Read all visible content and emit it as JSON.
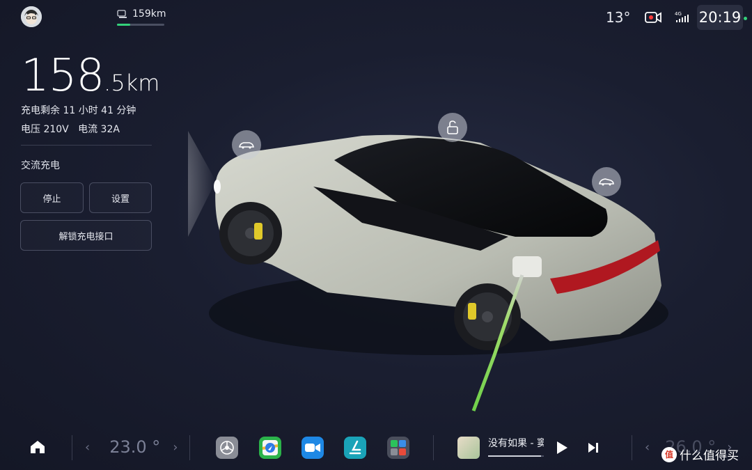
{
  "status_bar": {
    "range_short": "159km",
    "range_progress": 0.28,
    "outside_temp": "13°",
    "network": "4G",
    "time": "20:19"
  },
  "charging": {
    "range_int": "158",
    "range_dec": ".5km",
    "time_remaining": "充电剩余 11 小时 41 分钟",
    "voltage_current": "电压 210V   电流 32A",
    "mode": "交流充电",
    "stop_label": "停止",
    "settings_label": "设置",
    "unlock_port_label": "解锁充电接口"
  },
  "dock": {
    "left_temp": "23.0 °",
    "right_temp": "26.0 °",
    "apps": [
      "settings-icon",
      "navigation-icon",
      "video-call-icon",
      "seat-icon",
      "app-folder-icon"
    ],
    "song_title": "没有如果 - 窦",
    "song_progress": 0.95
  },
  "watermark": "什么值得买",
  "colors": {
    "accent_green": "#34d17a",
    "background": "#1a1e30",
    "car_body": "#c9cbc2",
    "cable_green": "#8bd85a"
  }
}
